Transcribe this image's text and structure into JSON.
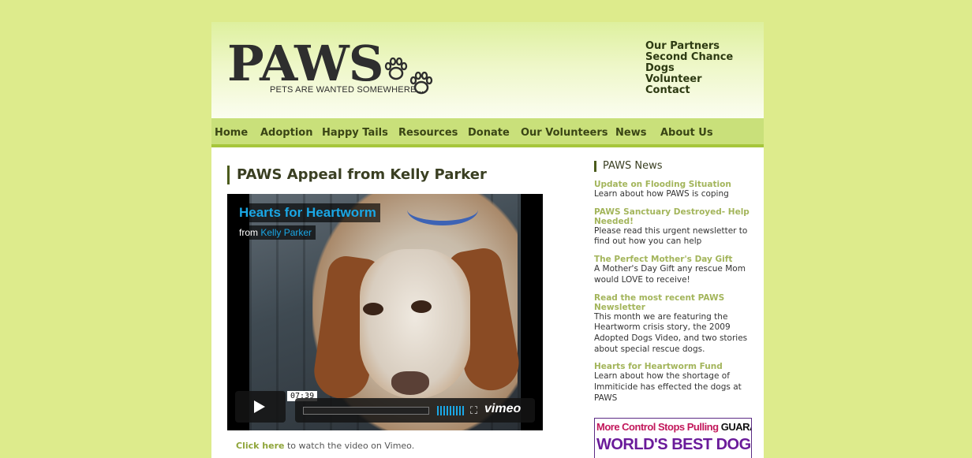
{
  "header": {
    "logo_word": "PAWS",
    "logo_tagline": "PETS ARE WANTED SOMEWHERE...",
    "top_links": [
      "Our Partners",
      "Second Chance Dogs",
      "Volunteer",
      "Contact"
    ]
  },
  "nav": {
    "items": [
      "Home",
      "Adoption",
      "Happy Tails",
      "Resources",
      "Donate",
      "Our Volunteers",
      "News",
      "About Us"
    ]
  },
  "main": {
    "title": "PAWS Appeal from Kelly Parker",
    "video": {
      "title": "Hearts for Heartworm",
      "from_label": "from",
      "author": "Kelly Parker",
      "duration": "07:39",
      "brand": "vimeo"
    },
    "watch_link": "Click here",
    "watch_text": "to watch the video on Vimeo."
  },
  "sidebar": {
    "heading": "PAWS News",
    "news": [
      {
        "title": "Update on Flooding Situation",
        "desc": "Learn about how PAWS is coping"
      },
      {
        "title": "PAWS Sanctuary Destroyed- Help Needed!",
        "desc": "Please read this urgent newsletter to find out how you can help"
      },
      {
        "title": "The Perfect Mother's Day Gift",
        "desc": "A Mother's Day Gift any rescue Mom would LOVE to receive!"
      },
      {
        "title": "Read the most recent PAWS Newsletter",
        "desc": "This month we are featuring the Heartworm crisis story, the 2009 Adopted Dogs Video, and two stories about special rescue dogs."
      },
      {
        "title": "Hearts for Heartworm Fund",
        "desc": "Learn about how the shortage of Immiticide has effected the dogs at PAWS"
      }
    ],
    "ad": {
      "part1": "More Control",
      "part2": "Stops Pulling",
      "part3": "GUARANTEED",
      "line2": "WORLD'S BEST DOG HARNESS"
    }
  },
  "colors": {
    "page_bg": "#ddeb8c",
    "nav_bg": "#c9e07a",
    "link_green": "#a3b55b",
    "vimeo_blue": "#1aa7e5"
  }
}
